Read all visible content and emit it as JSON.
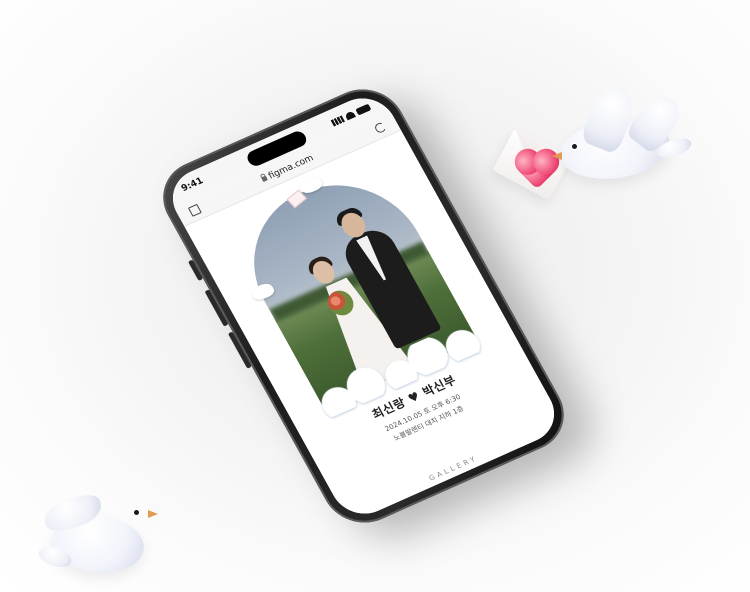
{
  "status_bar": {
    "time": "9:41"
  },
  "browser": {
    "url": "figma.com"
  },
  "invitation": {
    "couple_names": "최신랑 ♥ 박신부",
    "date_time": "2024.10.05 토 오후 6:30",
    "venue": "노블발렌티 대치 지하 1층",
    "gallery_heading": "GALLERY"
  },
  "colors": {
    "heart": "#f04d78",
    "beak": "#e39a52",
    "phone_frame": "#1c1c1c"
  },
  "icons": [
    "lock-icon",
    "tabs-icon",
    "reload-icon",
    "signal-icon",
    "wifi-icon",
    "battery-icon",
    "heart-icon",
    "dove-icon",
    "envelope-icon"
  ]
}
